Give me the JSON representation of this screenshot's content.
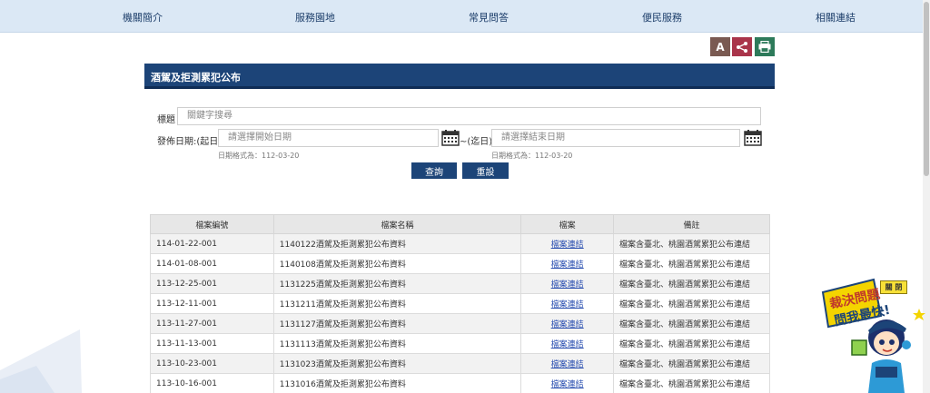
{
  "nav": {
    "items": [
      "機關簡介",
      "服務園地",
      "常見問答",
      "便民服務",
      "相關連結"
    ]
  },
  "tools": {
    "font_label": "A",
    "share_icon": "share-icon",
    "print_icon": "print-icon",
    "colors": {
      "font": "#7a5a52",
      "share": "#a9344a",
      "print": "#2d7a5a"
    }
  },
  "page": {
    "title": "酒駕及拒測累犯公布"
  },
  "search": {
    "title_label": "標題",
    "title_placeholder": "關鍵字搜尋",
    "date_label": "發佈日期:(起日)",
    "start_placeholder": "請選擇開始日期",
    "end_label": "~(迄日)",
    "end_placeholder": "請選擇結束日期",
    "date_hint": "日期格式為：112-03-20",
    "query_button": "查詢",
    "reset_button": "重設"
  },
  "table": {
    "headers": [
      "檔案編號",
      "檔案名稱",
      "檔案",
      "備註"
    ],
    "rows": [
      {
        "id": "114-01-22-001",
        "name": "1140122酒駕及拒測累犯公布資料",
        "file": "檔案連結",
        "note": "檔案含臺北、桃園酒駕累犯公布連結"
      },
      {
        "id": "114-01-08-001",
        "name": "1140108酒駕及拒測累犯公布資料",
        "file": "檔案連結",
        "note": "檔案含臺北、桃園酒駕累犯公布連結"
      },
      {
        "id": "113-12-25-001",
        "name": "1131225酒駕及拒測累犯公布資料",
        "file": "檔案連結",
        "note": "檔案含臺北、桃園酒駕累犯公布連結"
      },
      {
        "id": "113-12-11-001",
        "name": "1131211酒駕及拒測累犯公布資料",
        "file": "檔案連結",
        "note": "檔案含臺北、桃園酒駕累犯公布連結"
      },
      {
        "id": "113-11-27-001",
        "name": "1131127酒駕及拒測累犯公布資料",
        "file": "檔案連結",
        "note": "檔案含臺北、桃園酒駕累犯公布連結"
      },
      {
        "id": "113-11-13-001",
        "name": "1131113酒駕及拒測累犯公布資料",
        "file": "檔案連結",
        "note": "檔案含臺北、桃園酒駕累犯公布連結"
      },
      {
        "id": "113-10-23-001",
        "name": "1131023酒駕及拒測累犯公布資料",
        "file": "檔案連結",
        "note": "檔案含臺北、桃園酒駕累犯公布連結"
      },
      {
        "id": "113-10-16-001",
        "name": "1131016酒駕及拒測累犯公布資料",
        "file": "檔案連結",
        "note": "檔案含臺北、桃園酒駕累犯公布連結"
      }
    ]
  },
  "mascot": {
    "line1": "裁決問題",
    "line2": "問我最快!",
    "close_label": "關 閉"
  }
}
